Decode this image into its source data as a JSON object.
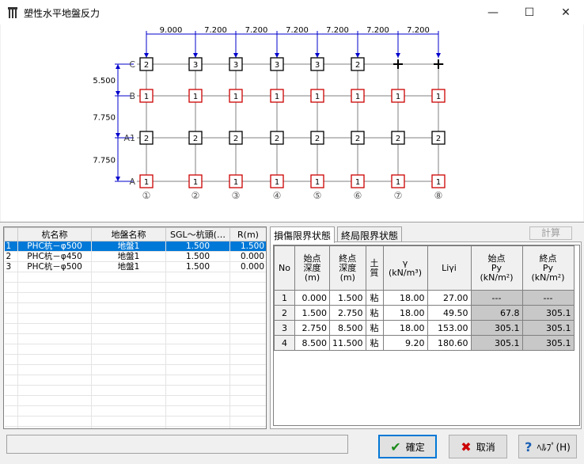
{
  "window": {
    "title": "塑性水平地盤反力",
    "minimize": "—",
    "maximize": "☐",
    "close": "✕"
  },
  "diagram": {
    "top_dims": [
      "9.000",
      "7.200",
      "7.200",
      "7.200",
      "7.200",
      "7.200",
      "7.200"
    ],
    "left_dims": [
      "5.500",
      "7.750",
      "7.750"
    ],
    "rows": [
      {
        "label": "C",
        "cells": [
          "2",
          "3",
          "3",
          "3",
          "3",
          "2",
          "",
          ""
        ],
        "color": "black"
      },
      {
        "label": "B",
        "cells": [
          "1",
          "1",
          "1",
          "1",
          "1",
          "1",
          "1",
          "1"
        ],
        "color": "red"
      },
      {
        "label": "A1",
        "cells": [
          "2",
          "2",
          "2",
          "2",
          "2",
          "2",
          "2",
          "2"
        ],
        "color": "black"
      },
      {
        "label": "A",
        "cells": [
          "1",
          "1",
          "1",
          "1",
          "1",
          "1",
          "1",
          "1"
        ],
        "color": "red"
      }
    ],
    "col_labels": [
      "①",
      "②",
      "③",
      "④",
      "⑤",
      "⑥",
      "⑦",
      "⑧"
    ],
    "colors": {
      "dim": "#0000cc",
      "red_box": "#cc0000",
      "black_box": "#000000",
      "grid_line": "#808080"
    }
  },
  "pile_table": {
    "headers": [
      "",
      "杭名称",
      "地盤名称",
      "SGL～杭頭(…",
      "R(m)"
    ],
    "rows": [
      [
        "1",
        "PHC杭－φ500",
        "地盤1",
        "1.500",
        "1.500"
      ],
      [
        "2",
        "PHC杭－φ450",
        "地盤1",
        "1.500",
        "0.000"
      ],
      [
        "3",
        "PHC杭－φ500",
        "地盤1",
        "1.500",
        "0.000"
      ]
    ]
  },
  "tabs": [
    "損傷限界状態",
    "終局限界状態"
  ],
  "calc_button": "計算",
  "layer_table": {
    "headers": [
      "No",
      "始点\n深度\n(m)",
      "終点\n深度\n(m)",
      "土\n質",
      "γ\n(kN/m³)",
      "Liγi",
      "始点\nPy\n(kN/m²)",
      "終点\nPy\n(kN/m²)"
    ],
    "rows": [
      [
        "1",
        "0.000",
        "1.500",
        "粘",
        "18.00",
        "27.00",
        "---",
        "---"
      ],
      [
        "2",
        "1.500",
        "2.750",
        "粘",
        "18.00",
        "49.50",
        "67.8",
        "305.1"
      ],
      [
        "3",
        "2.750",
        "8.500",
        "粘",
        "18.00",
        "153.00",
        "305.1",
        "305.1"
      ],
      [
        "4",
        "8.500",
        "11.500",
        "粘",
        "9.20",
        "180.60",
        "305.1",
        "305.1"
      ]
    ]
  },
  "buttons": {
    "ok": "確定",
    "cancel": "取消",
    "help": "ﾍﾙﾌﾟ(H)"
  },
  "status_text": ""
}
